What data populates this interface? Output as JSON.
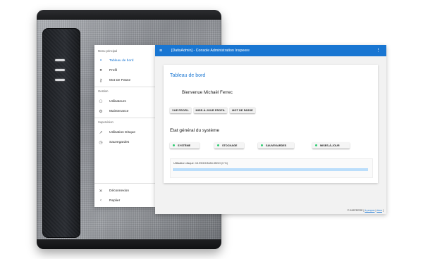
{
  "drawer": {
    "sections": {
      "main": "Menu principal",
      "management": "Gestion",
      "supervision": "Supervision"
    },
    "items": [
      {
        "label": "Tableau de bord",
        "icon": "home-icon"
      },
      {
        "label": "Profil",
        "icon": "person-icon"
      },
      {
        "label": "Mot De Passe",
        "icon": "key-icon"
      },
      {
        "label": "Utilisateurs",
        "icon": "people-icon"
      },
      {
        "label": "Maintenance",
        "icon": "gear-icon"
      },
      {
        "label": "Utilisation Disque",
        "icon": "chart-icon"
      },
      {
        "label": "Sauvegardes",
        "icon": "history-icon"
      },
      {
        "label": "Déconnexion",
        "icon": "close-icon"
      },
      {
        "label": "Replier",
        "icon": "chevron-left-icon"
      }
    ]
  },
  "appbar": {
    "title": "[DatisAdmin] - Console Administration Inspeere"
  },
  "dashboard": {
    "title": "Tableau de bord",
    "welcome": "Bienvenue Michaël Ferrec",
    "buttons": [
      "VUE PROFIL",
      "MISE-À-JOUR PROFIL",
      "MOT DE PASSE"
    ],
    "state_title": "Etat général du système",
    "statuses": [
      "SYSTÈME",
      "STOCKAGE",
      "SAUVEGARDES",
      "MISES-À-JOUR"
    ],
    "disk_label": "Utilisation disque: 15.99GO/3484.35GO (0 %)",
    "disk_usage_fraction": 0.005
  },
  "footer": {
    "brand": "© INSPEERE",
    "link1": "à propos",
    "link2": "docs"
  },
  "colors": {
    "primary": "#1976d2",
    "status_ok": "#2ecc71",
    "disk_bar": "#bbdefb"
  }
}
